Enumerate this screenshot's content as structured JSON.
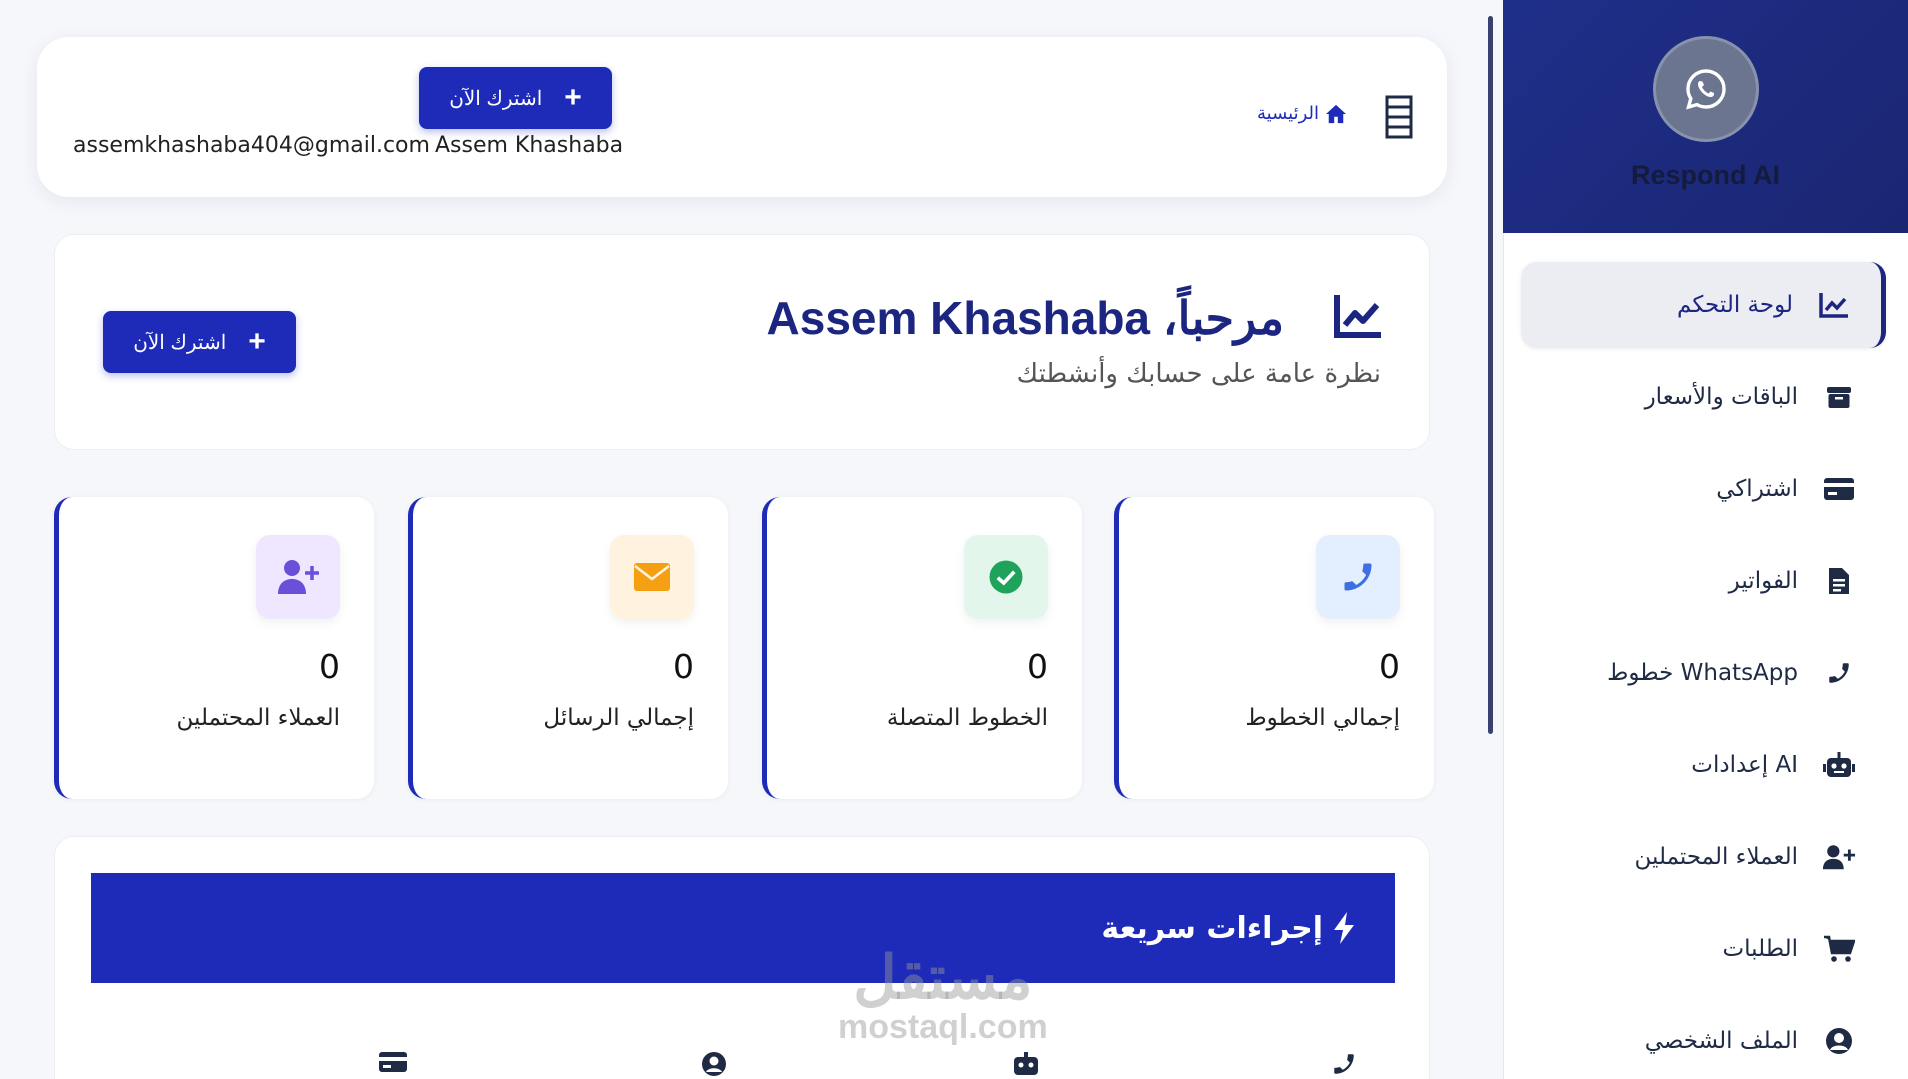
{
  "brand": {
    "name": "Respond AI",
    "logo_icon": "whatsapp-icon"
  },
  "header": {
    "subscribe_label": "اشترك الآن",
    "user_name": "Assem Khashaba",
    "user_email": "assemkhashaba404@gmail.com",
    "breadcrumb_home": "الرئيسية"
  },
  "welcome": {
    "title": "مرحباً، Assem Khashaba",
    "subtitle": "نظرة عامة على حسابك وأنشطتك",
    "subscribe_label": "اشترك الآن"
  },
  "stats": [
    {
      "label": "إجمالي الخطوط",
      "value": "0",
      "icon": "phone-icon",
      "bg": "#e3efff",
      "color": "#3d6fe0"
    },
    {
      "label": "الخطوط المتصلة",
      "value": "0",
      "icon": "check-circle-icon",
      "bg": "#e3f6ec",
      "color": "#1fa35a"
    },
    {
      "label": "إجمالي الرسائل",
      "value": "0",
      "icon": "envelope-icon",
      "bg": "#fff3e0",
      "color": "#f5a012"
    },
    {
      "label": "العملاء المحتملين",
      "value": "0",
      "icon": "user-plus-icon",
      "bg": "#efe6ff",
      "color": "#6a4fd8"
    }
  ],
  "quick_actions": {
    "title": "إجراءات سريعة"
  },
  "sidebar": {
    "items": [
      {
        "label": "لوحة التحكم",
        "icon": "chart-line-icon",
        "active": true
      },
      {
        "label": "الباقات والأسعار",
        "icon": "box-icon"
      },
      {
        "label": "اشتراكي",
        "icon": "credit-card-icon"
      },
      {
        "label": "الفواتير",
        "icon": "invoice-icon"
      },
      {
        "label": "خطوط WhatsApp",
        "icon": "phone-icon"
      },
      {
        "label": "إعدادات AI",
        "icon": "robot-icon"
      },
      {
        "label": "العملاء المحتملين",
        "icon": "user-plus-icon"
      },
      {
        "label": "الطلبات",
        "icon": "cart-icon"
      },
      {
        "label": "الملف الشخصي",
        "icon": "user-circle-icon"
      }
    ]
  },
  "watermark": {
    "line1": "مستقل",
    "line2": "mostaql.com"
  },
  "colors": {
    "primary": "#1e2bb8",
    "sidebar_header": "#1e2f8a"
  }
}
